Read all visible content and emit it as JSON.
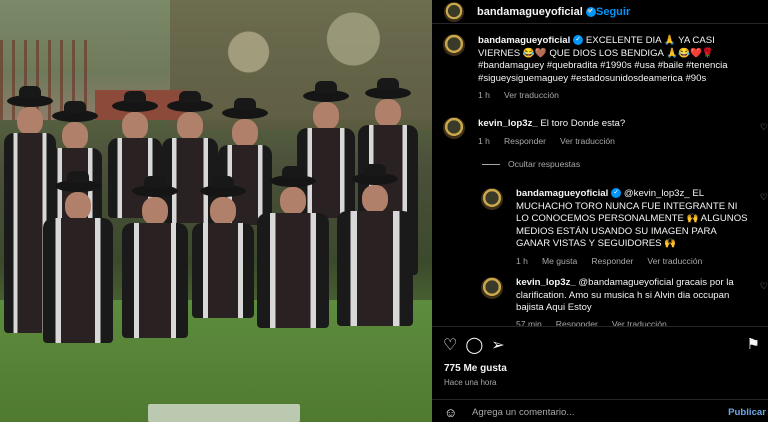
{
  "post": {
    "username": "bandamagueyoficial",
    "follow_label": "Seguir",
    "separator": "•"
  },
  "caption": {
    "username": "bandamagueyoficial",
    "text": "EXCELENTE DIA 🙏 YA CASI VIERNES 😂🤎 QUE DIOS LOS BENDIGA 🙏😂❤️🌹 #bandamaguey #quebradita #1990s #usa #baile #tenencia #sigueysiguemaguey #estadosunidosdeamerica #90s",
    "time": "1 h",
    "translate": "Ver traducción"
  },
  "comments": [
    {
      "username": "kevin_lop3z_",
      "text": "El toro Donde esta?",
      "time": "1 h",
      "reply": "Responder",
      "translate": "Ver traducción"
    },
    {
      "username": "bandamagueyoficial",
      "text": "@kevin_lop3z_ EL MUCHACHO TORO NUNCA FUE INTEGRANTE NI LO CONOCEMOS PERSONALMENTE 🙌 ALGUNOS MEDIOS ESTÁN USANDO SU IMAGEN PARA GANAR VISTAS Y SEGUIDORES 🙌",
      "time": "1 h",
      "likes": "Me gusta",
      "reply": "Responder",
      "translate": "Ver traducción"
    },
    {
      "username": "kevin_lop3z_",
      "text": "@bandamagueyoficial gracais por la clarification. Amo su musica h si Alvin dia occupan bajista Aqui Estoy",
      "time": "57 min",
      "reply": "Responder",
      "translate": "Ver traducción"
    }
  ],
  "hidden_replies": "Ocultar respuestas",
  "footer": {
    "likes": "775 Me gusta",
    "time": "Hace una hora",
    "add_comment_placeholder": "Agrega un comentario...",
    "publish": "Publicar"
  },
  "icons": {
    "like": "heart-icon",
    "comment": "comment-icon",
    "share": "share-icon",
    "save": "bookmark-icon",
    "emoji": "emoji-icon"
  },
  "colors": {
    "accent": "#0095f6",
    "background": "#000000",
    "muted": "#a8a8a8"
  }
}
